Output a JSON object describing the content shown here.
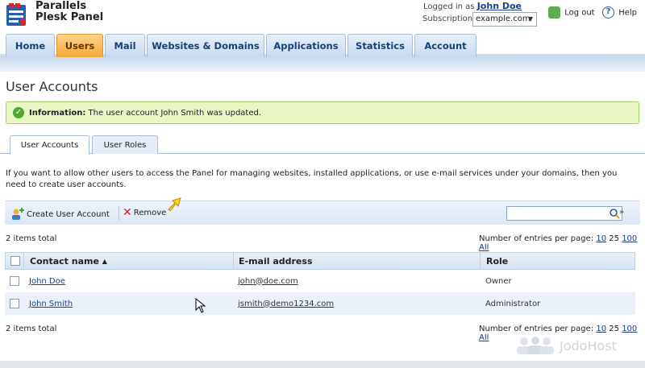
{
  "header": {
    "app_title_line1": "Parallels",
    "app_title_line2": "Plesk Panel",
    "logged_in_label": "Logged in as",
    "user_name": "John Doe",
    "subscription_label": "Subscription",
    "subscription_value": "example.com",
    "logout_label": "Log out",
    "help_label": "Help"
  },
  "nav": {
    "tabs": [
      {
        "label": "Home"
      },
      {
        "label": "Users"
      },
      {
        "label": "Mail"
      },
      {
        "label": "Websites & Domains"
      },
      {
        "label": "Applications"
      },
      {
        "label": "Statistics"
      },
      {
        "label": "Account"
      }
    ],
    "active": "Users"
  },
  "page": {
    "title": "User Accounts",
    "info_bold": "Information:",
    "info_text": "The user account John Smith was updated.",
    "subtabs": [
      {
        "label": "User Accounts"
      },
      {
        "label": "User Roles"
      }
    ],
    "description": "If you want to allow other users to access the Panel for managing websites, installed applications, or use e-mail services under your domains, then you need to create user accounts."
  },
  "toolbar": {
    "create_label": "Create User Account",
    "remove_label": "Remove",
    "search_value": ""
  },
  "listing": {
    "items_total": "2 items total",
    "per_page_label": "Number of entries per page:",
    "per_page_options": [
      "10",
      "25",
      "100",
      "All"
    ],
    "per_page_current": "25",
    "columns": {
      "contact": "Contact name",
      "sort_arrow": "▲",
      "email": "E-mail address",
      "role": "Role"
    },
    "rows": [
      {
        "name": "John Doe",
        "email": "john@doe.com",
        "role": "Owner"
      },
      {
        "name": "John Smith",
        "email": "jsmith@demo1234.com",
        "role": "Administrator"
      }
    ]
  },
  "watermark": "JodoHost",
  "colors": {
    "active_tab": "#f5a833",
    "nav_tab": "#c8d9ee",
    "info_bg": "#e9f7c5",
    "link": "#1a3e8a"
  }
}
